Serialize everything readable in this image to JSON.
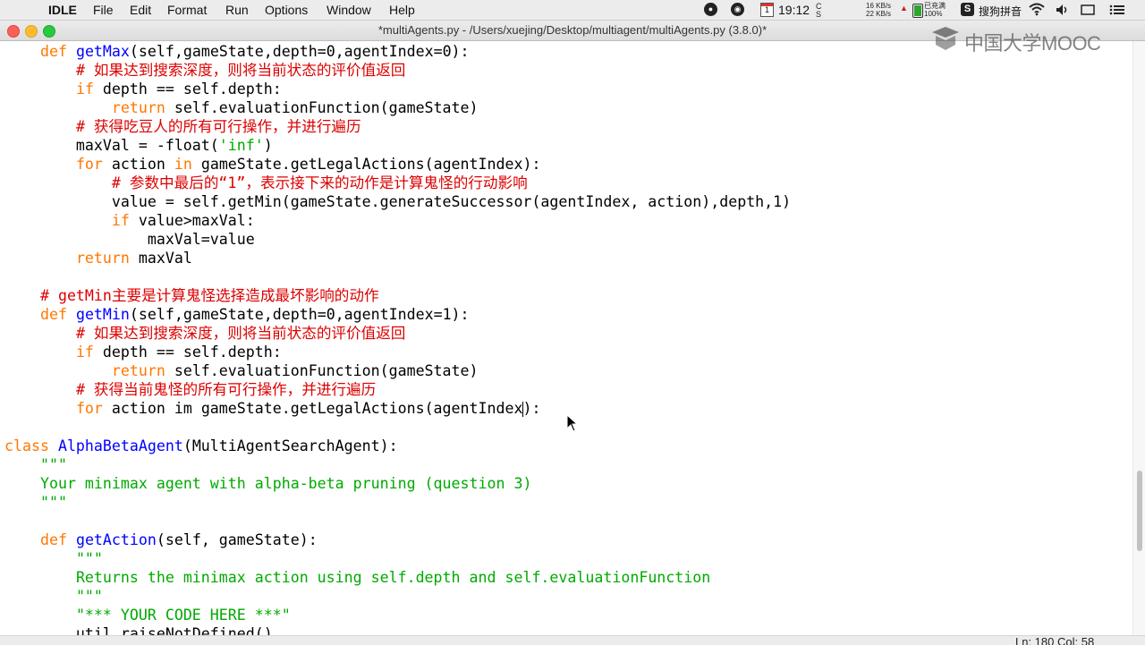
{
  "menubar": {
    "app": "IDLE",
    "menus": [
      "File",
      "Edit",
      "Format",
      "Run",
      "Options",
      "Window",
      "Help"
    ],
    "time": "19:12",
    "net_up": "16 KB/s",
    "net_down": "22 KB/s",
    "battery_status": "已充满",
    "battery_percent": "100%",
    "calendar_day": "1",
    "input_method": "搜狗拼音"
  },
  "window": {
    "title": "*multiAgents.py - /Users/xuejing/Desktop/multiagent/multiAgents.py (3.8.0)*"
  },
  "watermark": {
    "text": "中国大学MOOC"
  },
  "statusbar": {
    "position": "Ln: 180   Col: 58"
  },
  "colors": {
    "keyword": "#ff7700",
    "definition": "#0000ff",
    "comment": "#dd0000",
    "string": "#00aa00",
    "text": "#000000"
  },
  "code_lines": [
    [
      {
        "t": "    "
      },
      {
        "t": "def",
        "c": "kw"
      },
      {
        "t": " "
      },
      {
        "t": "getMax",
        "c": "fn"
      },
      {
        "t": "(self,gameState,depth=0,agentIndex=0):"
      }
    ],
    [
      {
        "t": "        "
      },
      {
        "t": "# 如果达到搜索深度，则将当前状态的评价值返回",
        "c": "cm"
      }
    ],
    [
      {
        "t": "        "
      },
      {
        "t": "if",
        "c": "kw"
      },
      {
        "t": " depth == self.depth:"
      }
    ],
    [
      {
        "t": "            "
      },
      {
        "t": "return",
        "c": "kw"
      },
      {
        "t": " self.evaluationFunction(gameState)"
      }
    ],
    [
      {
        "t": "        "
      },
      {
        "t": "# 获得吃豆人的所有可行操作，并进行遍历",
        "c": "cm"
      }
    ],
    [
      {
        "t": "        maxVal = -float("
      },
      {
        "t": "'inf'",
        "c": "st"
      },
      {
        "t": ")"
      }
    ],
    [
      {
        "t": "        "
      },
      {
        "t": "for",
        "c": "kw"
      },
      {
        "t": " action "
      },
      {
        "t": "in",
        "c": "kw"
      },
      {
        "t": " gameState.getLegalActions(agentIndex):"
      }
    ],
    [
      {
        "t": "            "
      },
      {
        "t": "# 参数中最后的“1”，表示接下来的动作是计算鬼怪的行动影响",
        "c": "cm"
      }
    ],
    [
      {
        "t": "            value = self.getMin(gameState.generateSuccessor(agentIndex, action),depth,1)"
      }
    ],
    [
      {
        "t": "            "
      },
      {
        "t": "if",
        "c": "kw"
      },
      {
        "t": " value>maxVal:"
      }
    ],
    [
      {
        "t": "                maxVal=value"
      }
    ],
    [
      {
        "t": "        "
      },
      {
        "t": "return",
        "c": "kw"
      },
      {
        "t": " maxVal"
      }
    ],
    [],
    [
      {
        "t": "    "
      },
      {
        "t": "# getMin主要是计算鬼怪选择造成最坏影响的动作",
        "c": "cm"
      }
    ],
    [
      {
        "t": "    "
      },
      {
        "t": "def",
        "c": "kw"
      },
      {
        "t": " "
      },
      {
        "t": "getMin",
        "c": "fn"
      },
      {
        "t": "(self,gameState,depth=0,agentIndex=1):"
      }
    ],
    [
      {
        "t": "        "
      },
      {
        "t": "# 如果达到搜索深度，则将当前状态的评价值返回",
        "c": "cm"
      }
    ],
    [
      {
        "t": "        "
      },
      {
        "t": "if",
        "c": "kw"
      },
      {
        "t": " depth == self.depth:"
      }
    ],
    [
      {
        "t": "            "
      },
      {
        "t": "return",
        "c": "kw"
      },
      {
        "t": " self.evaluationFunction(gameState)"
      }
    ],
    [
      {
        "t": "        "
      },
      {
        "t": "# 获得当前鬼怪的所有可行操作，并进行遍历",
        "c": "cm"
      }
    ],
    [
      {
        "t": "        "
      },
      {
        "t": "for",
        "c": "kw"
      },
      {
        "t": " action im gameState.getLegalActions(agentIndex"
      },
      {
        "t": "",
        "cursor": true
      },
      {
        "t": "):"
      }
    ],
    [],
    [
      {
        "t": "class",
        "c": "kw"
      },
      {
        "t": " "
      },
      {
        "t": "AlphaBetaAgent",
        "c": "fn"
      },
      {
        "t": "(MultiAgentSearchAgent):"
      }
    ],
    [
      {
        "t": "    "
      },
      {
        "t": "\"\"\"",
        "c": "st"
      }
    ],
    [
      {
        "t": "    "
      },
      {
        "t": "Your minimax agent with alpha-beta pruning (question 3)",
        "c": "st"
      }
    ],
    [
      {
        "t": "    "
      },
      {
        "t": "\"\"\"",
        "c": "st"
      }
    ],
    [],
    [
      {
        "t": "    "
      },
      {
        "t": "def",
        "c": "kw"
      },
      {
        "t": " "
      },
      {
        "t": "getAction",
        "c": "fn"
      },
      {
        "t": "(self, gameState):"
      }
    ],
    [
      {
        "t": "        "
      },
      {
        "t": "\"\"\"",
        "c": "st"
      }
    ],
    [
      {
        "t": "        "
      },
      {
        "t": "Returns the minimax action using self.depth and self.evaluationFunction",
        "c": "st"
      }
    ],
    [
      {
        "t": "        "
      },
      {
        "t": "\"\"\"",
        "c": "st"
      }
    ],
    [
      {
        "t": "        "
      },
      {
        "t": "\"*** YOUR CODE HERE ***\"",
        "c": "st"
      }
    ],
    [
      {
        "t": "        util.raiseNotDefined()"
      }
    ]
  ]
}
